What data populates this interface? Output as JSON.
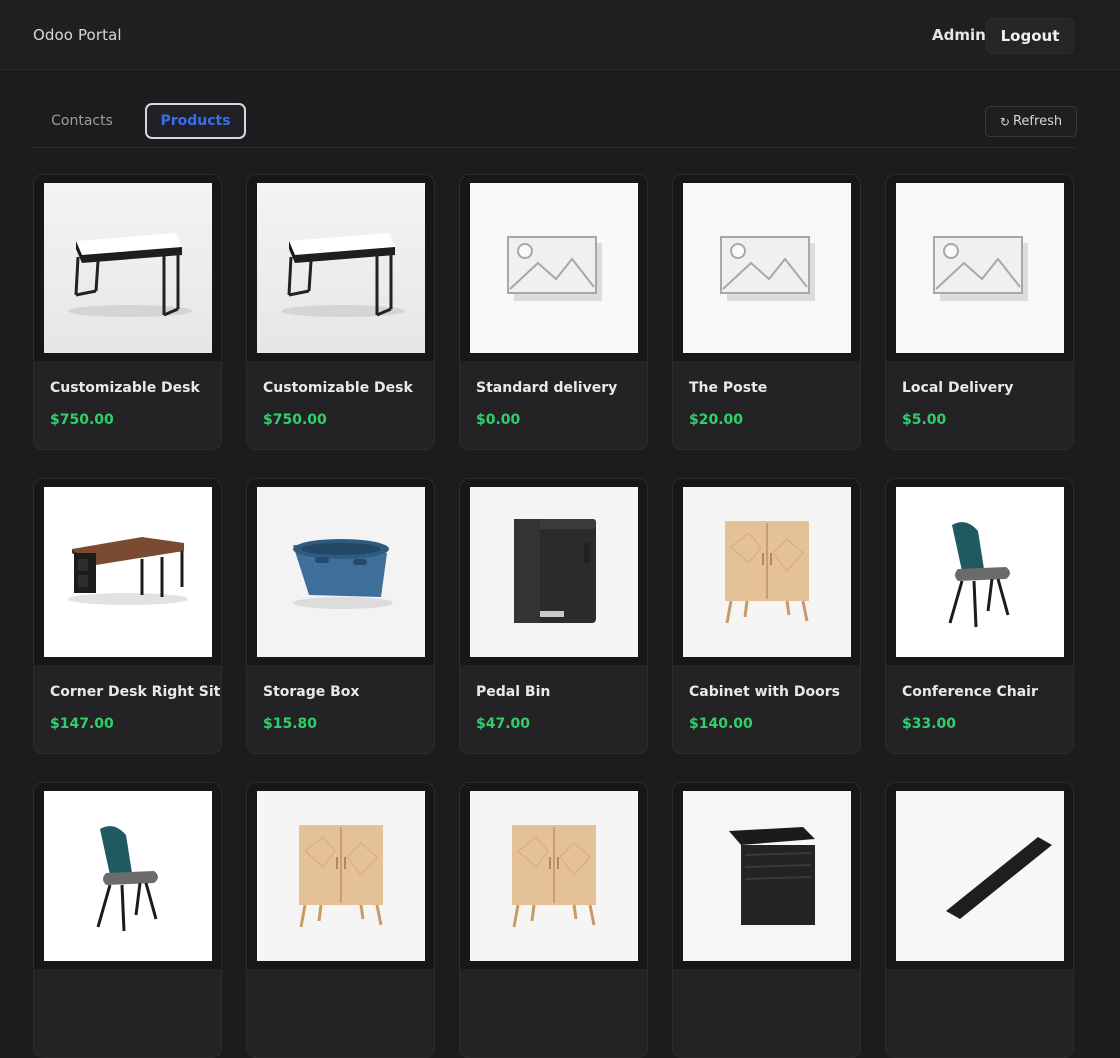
{
  "header": {
    "brand": "Odoo Portal",
    "user": "Admin",
    "logout_label": "Logout"
  },
  "tabs": [
    {
      "label": "Contacts",
      "active": false
    },
    {
      "label": "Products",
      "active": true
    }
  ],
  "toolbar": {
    "refresh_icon": "↻",
    "refresh_label": "Refresh"
  },
  "colors": {
    "accent": "#3a6cf0",
    "price": "#2fd06a",
    "background": "#1c1c1e"
  },
  "products": [
    {
      "name": "Customizable Desk",
      "price": "$750.00",
      "image": "desk-icon"
    },
    {
      "name": "Customizable Desk",
      "price": "$750.00",
      "image": "desk-icon"
    },
    {
      "name": "Standard delivery",
      "price": "$0.00",
      "image": "placeholder-image-icon"
    },
    {
      "name": "The Poste",
      "price": "$20.00",
      "image": "placeholder-image-icon"
    },
    {
      "name": "Local Delivery",
      "price": "$5.00",
      "image": "placeholder-image-icon"
    },
    {
      "name": "Corner Desk Right Sit",
      "price": "$147.00",
      "image": "corner-desk-icon"
    },
    {
      "name": "Storage Box",
      "price": "$15.80",
      "image": "storage-box-icon"
    },
    {
      "name": "Pedal Bin",
      "price": "$47.00",
      "image": "pedal-bin-icon"
    },
    {
      "name": "Cabinet with Doors",
      "price": "$140.00",
      "image": "cabinet-icon"
    },
    {
      "name": "Conference Chair",
      "price": "$33.00",
      "image": "chair-icon"
    },
    {
      "name": "",
      "price": "",
      "image": "chair-icon"
    },
    {
      "name": "",
      "price": "",
      "image": "cabinet-icon"
    },
    {
      "name": "",
      "price": "",
      "image": "cabinet-icon"
    },
    {
      "name": "",
      "price": "",
      "image": "drawer-icon"
    },
    {
      "name": "",
      "price": "",
      "image": "desk-top-icon"
    }
  ]
}
